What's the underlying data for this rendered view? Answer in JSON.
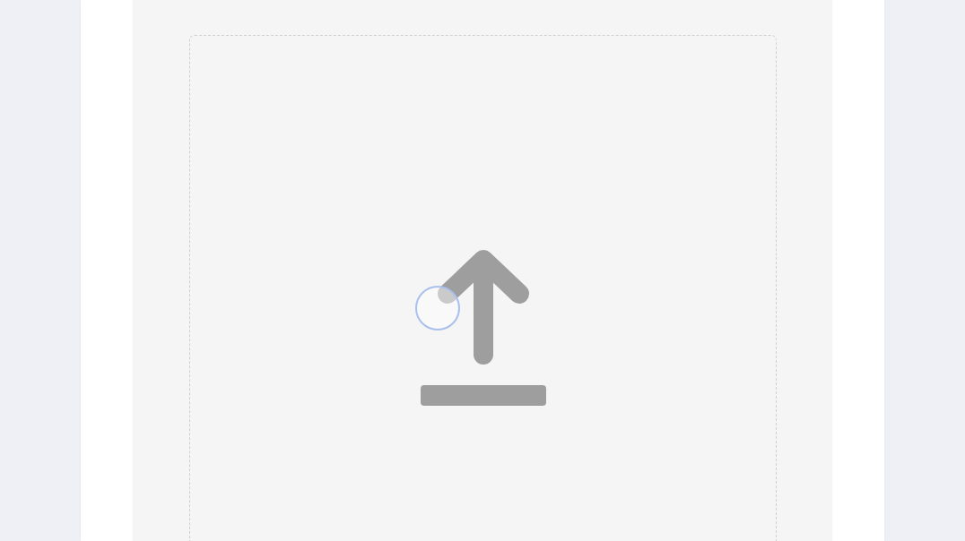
{
  "drop_zone": {
    "dashed": true
  },
  "touch_indicator": {
    "visible": true
  }
}
